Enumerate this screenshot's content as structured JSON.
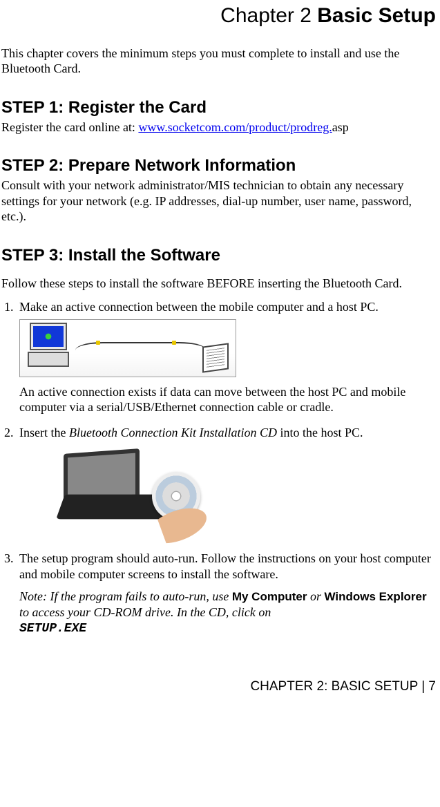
{
  "title": {
    "pre": "Chapter 2 ",
    "main": "Basic Setup"
  },
  "intro": "This chapter covers the minimum steps you must complete to install and use the Bluetooth Card.",
  "step1": {
    "heading": "STEP 1: Register the Card",
    "pre": "Register the card online at: ",
    "link": "www.socketcom.com/product/prodreg.",
    "post": "asp"
  },
  "step2": {
    "heading": "STEP 2: Prepare Network Information",
    "body": "Consult with your network administrator/MIS technician to obtain any necessary settings for your network (e.g. IP addresses, dial-up number, user name, password, etc.)."
  },
  "step3": {
    "heading": "STEP 3: Install the Software",
    "lead": "Follow these steps to install the software BEFORE inserting the Bluetooth Card.",
    "item1_a": "Make an active connection between the mobile computer and a host PC.",
    "item1_b": "An active connection exists if data can move between the host PC and mobile computer via a serial/USB/Ethernet connection cable or cradle.",
    "item2_a_pre": "Insert the ",
    "item2_a_em": "Bluetooth Connection Kit Installation CD",
    "item2_a_post": " into the host PC.",
    "item3_a": "The setup program should auto-run. Follow the instructions on your host computer and mobile computer screens to install the software.",
    "item3_note_pre": "Note: If the program fails to auto-run, use ",
    "item3_note_mc": "My Computer",
    "item3_note_or": " or ",
    "item3_note_we": "Windows Explorer",
    "item3_note_mid": " to access your CD-ROM drive. In the CD, click on ",
    "item3_note_exe": "SETUP.EXE"
  },
  "footer": "CHAPTER 2: BASIC SETUP | 7"
}
